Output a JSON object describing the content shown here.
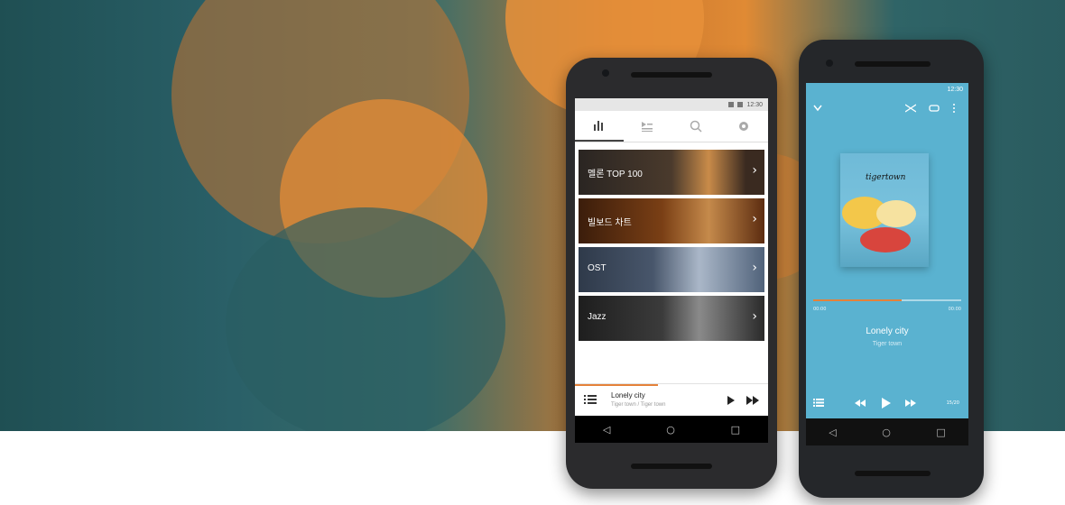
{
  "phone_left": {
    "status_time": "12:30",
    "tabs": [
      {
        "icon": "chart-bars-icon"
      },
      {
        "icon": "playlist-icon"
      },
      {
        "icon": "search-icon"
      },
      {
        "icon": "gear-icon"
      }
    ],
    "categories": [
      {
        "label": "멜론 TOP 100"
      },
      {
        "label": "빌보드 차트"
      },
      {
        "label": "OST"
      },
      {
        "label": "Jazz"
      }
    ],
    "mini_player": {
      "title": "Lonely city",
      "subtitle": "Tiger town / Tiger town",
      "progress": 0.43
    }
  },
  "phone_right": {
    "status_time": "12:30",
    "album_logo": "tigertown",
    "time_elapsed": "00:00",
    "time_total": "00:00",
    "progress": 0.6,
    "song_title": "Lonely city",
    "artist": "Tiger town",
    "track_counter": "15/20"
  },
  "colors": {
    "accent": "#e4823a",
    "player_bg": "#5ab2d0"
  }
}
